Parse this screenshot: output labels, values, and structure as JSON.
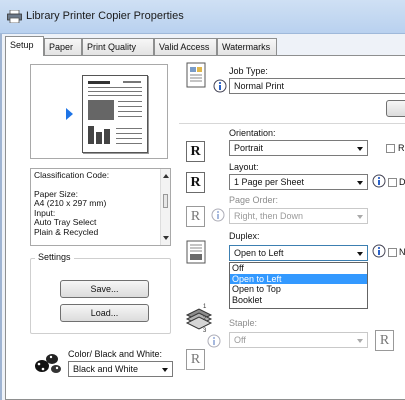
{
  "window": {
    "title": "Library Printer Copier Properties"
  },
  "tabs": [
    {
      "label": "Setup",
      "active": true
    },
    {
      "label": "Paper"
    },
    {
      "label": "Print Quality"
    },
    {
      "label": "Valid Access"
    },
    {
      "label": "Watermarks"
    }
  ],
  "classification": {
    "lines": [
      "Classification Code:",
      "",
      "Paper Size:",
      "A4 (210 x 297 mm)",
      "Input:",
      "Auto Tray Select",
      "Plain & Recycled"
    ]
  },
  "settings": {
    "group_label": "Settings",
    "save_label": "Save...",
    "load_label": "Load..."
  },
  "color": {
    "label": "Color/ Black and White:",
    "value": "Black and White"
  },
  "job_type": {
    "label": "Job Type:",
    "value": "Normal Print"
  },
  "orientation": {
    "label": "Orientation:",
    "value": "Portrait",
    "icon_letter": "R",
    "checkbox_text": "R"
  },
  "layout": {
    "label": "Layout:",
    "value": "1 Page per Sheet",
    "icon_letter": "R",
    "checkbox_text": "D"
  },
  "page_order": {
    "label": "Page Order:",
    "value": "Right, then Down",
    "icon_letter": "R"
  },
  "duplex": {
    "label": "Duplex:",
    "value": "Open to Left",
    "checkbox_text": "N",
    "options": [
      "Off",
      "Open to Left",
      "Open to Top",
      "Booklet"
    ],
    "selected_index": 1
  },
  "staple": {
    "label": "Staple:",
    "value": "Off",
    "icon_letter": "R"
  },
  "colors": {
    "selection": "#3399ff",
    "arrow": "#1e74e6",
    "titlebar": "#c4d9f2"
  }
}
